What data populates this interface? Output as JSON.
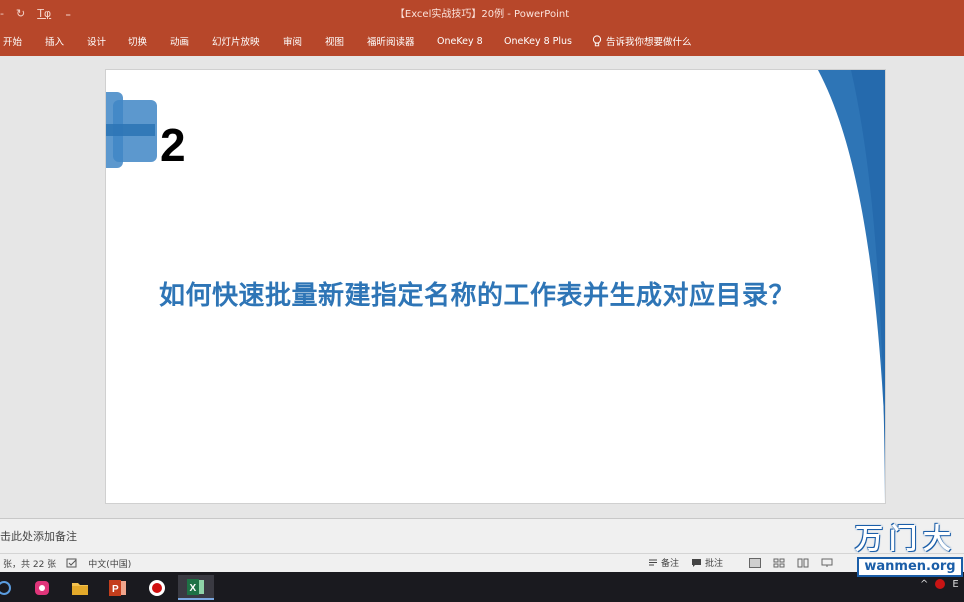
{
  "window": {
    "title": "【Excel实战技巧】20例  -  PowerPoint",
    "qat_items": [
      "-",
      "↻",
      "Tφ",
      "₌"
    ]
  },
  "ribbon": {
    "tabs": [
      "开始",
      "插入",
      "设计",
      "切换",
      "动画",
      "幻灯片放映",
      "审阅",
      "视图",
      "福昕阅读器",
      "OneKey 8",
      "OneKey 8 Plus"
    ],
    "tell_me": "告诉我你想要做什么"
  },
  "slide": {
    "number": "2",
    "headline": "如何快速批量新建指定名称的工作表并生成对应目录？",
    "colors": {
      "accent": "#2e75b6",
      "logo": "#3f86c6",
      "headline": "#2e75b6"
    }
  },
  "notes": {
    "placeholder": "击此处添加备注"
  },
  "status": {
    "slide_info": "张，共 22 张",
    "language": "中文(中国)",
    "notes_button": "备注",
    "comments_button": "批注"
  },
  "watermark": {
    "brand": "万门大",
    "site": "wanmen.org"
  },
  "tray": {
    "letter": "E"
  }
}
